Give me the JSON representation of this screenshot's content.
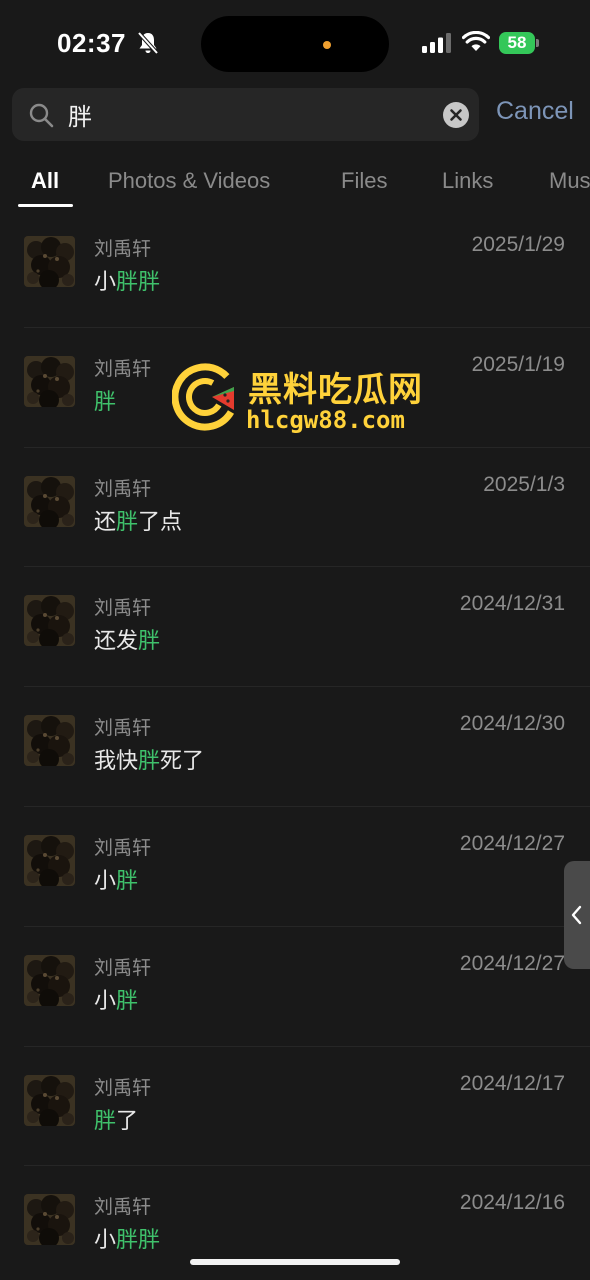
{
  "status_bar": {
    "time": "02:37",
    "battery": "58"
  },
  "search": {
    "query": "胖",
    "cancel_label": "Cancel"
  },
  "tabs": [
    {
      "label": "All",
      "active": true
    },
    {
      "label": "Photos & Videos",
      "active": false
    },
    {
      "label": "Files",
      "active": false
    },
    {
      "label": "Links",
      "active": false
    },
    {
      "label": "Mus",
      "active": false
    }
  ],
  "results": [
    {
      "sender": "刘禹轩",
      "date": "2025/1/29",
      "message": "小胖胖"
    },
    {
      "sender": "刘禹轩",
      "date": "2025/1/19",
      "message": "胖"
    },
    {
      "sender": "刘禹轩",
      "date": "2025/1/3",
      "message": "还胖了点"
    },
    {
      "sender": "刘禹轩",
      "date": "2024/12/31",
      "message": "还发胖"
    },
    {
      "sender": "刘禹轩",
      "date": "2024/12/30",
      "message": "我快胖死了"
    },
    {
      "sender": "刘禹轩",
      "date": "2024/12/27",
      "message": "小胖"
    },
    {
      "sender": "刘禹轩",
      "date": "2024/12/27",
      "message": "小胖"
    },
    {
      "sender": "刘禹轩",
      "date": "2024/12/17",
      "message": "胖了"
    },
    {
      "sender": "刘禹轩",
      "date": "2024/12/16",
      "message": "小胖胖"
    }
  ],
  "watermark": {
    "title": "黑料吃瓜网",
    "url": "hlcgw88.com"
  },
  "colors": {
    "highlight": "#3fc16b",
    "accent": "#7d95b8",
    "background": "#191919",
    "watermark": "#ffd23a"
  }
}
